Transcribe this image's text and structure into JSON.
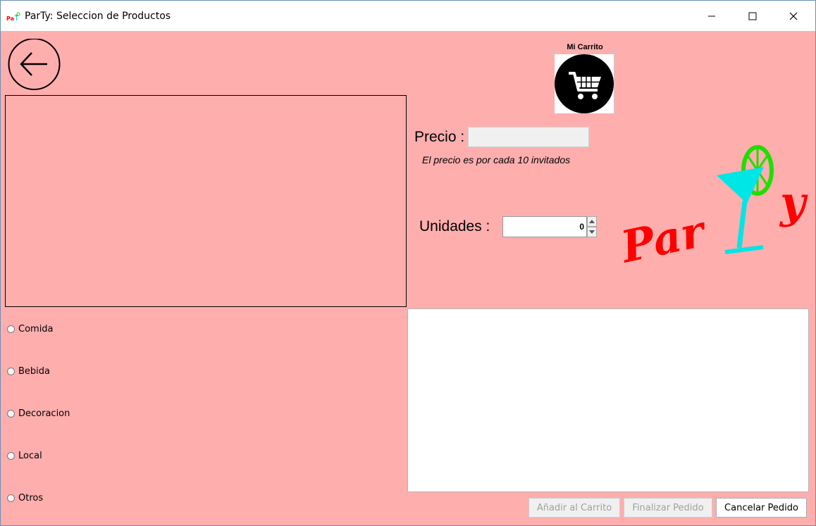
{
  "window": {
    "title": "ParTy: Seleccion de Productos"
  },
  "icons": {
    "app": "party-app-icon",
    "back": "arrow-left-icon",
    "cart": "shopping-cart-icon",
    "minimize": "minimize-icon",
    "maximize": "maximize-icon",
    "close": "close-icon"
  },
  "cart": {
    "label": "Mi Carrito"
  },
  "precio": {
    "label": "Precio :",
    "value": "",
    "note": "El precio es por cada 10 invitados"
  },
  "unidades": {
    "label": "Unidades :",
    "value": "0"
  },
  "logo": {
    "text_left": "Par",
    "text_right": "y"
  },
  "categories": [
    {
      "label": "Comida",
      "selected": false
    },
    {
      "label": "Bebida",
      "selected": false
    },
    {
      "label": "Decoracion",
      "selected": false
    },
    {
      "label": "Local",
      "selected": false
    },
    {
      "label": "Otros",
      "selected": false
    }
  ],
  "buttons": {
    "add": "Añadir al Carrito",
    "finish": "Finalizar Pedido",
    "cancel": "Cancelar Pedido"
  },
  "colors": {
    "background": "#ffaeae",
    "logo_text": "#ff0000",
    "glass": "#00e5e5",
    "lime": "#22dd00"
  }
}
